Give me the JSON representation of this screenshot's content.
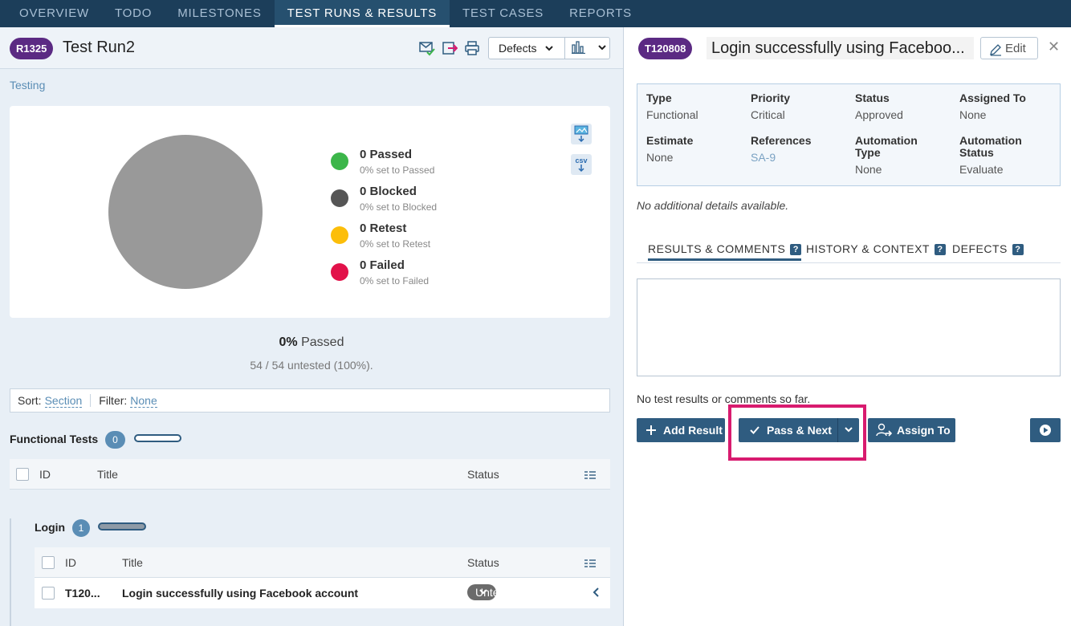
{
  "nav": {
    "tabs": [
      "OVERVIEW",
      "TODO",
      "MILESTONES",
      "TEST RUNS & RESULTS",
      "TEST CASES",
      "REPORTS"
    ],
    "active": "TEST RUNS & RESULTS"
  },
  "run": {
    "id": "R1325",
    "title": "Test Run2",
    "defects_label": "Defects",
    "link": "Testing"
  },
  "summary": {
    "legend": [
      {
        "main": "0 Passed",
        "sub": "0% set to Passed",
        "color": "#3cb64a"
      },
      {
        "main": "0 Blocked",
        "sub": "0% set to Blocked",
        "color": "#555555"
      },
      {
        "main": "0 Retest",
        "sub": "0% set to Retest",
        "color": "#fcbe0a"
      },
      {
        "main": "0 Failed",
        "sub": "0% set to Failed",
        "color": "#e2124a"
      }
    ],
    "csv_label": "csv",
    "passed_pct": "0%",
    "passed_word": "Passed",
    "untested": "54 / 54 untested (100%)."
  },
  "chart_data": {
    "type": "pie",
    "categories": [
      "Passed",
      "Blocked",
      "Retest",
      "Failed",
      "Untested"
    ],
    "values": [
      0,
      0,
      0,
      0,
      54
    ]
  },
  "sortbar": {
    "sort_label": "Sort:",
    "sort_value": "Section",
    "filter_label": "Filter:",
    "filter_value": "None"
  },
  "functional": {
    "title": "Functional Tests",
    "count": "0",
    "columns": {
      "id": "ID",
      "title": "Title",
      "status": "Status"
    }
  },
  "login": {
    "title": "Login",
    "count": "1",
    "columns": {
      "id": "ID",
      "title": "Title",
      "status": "Status"
    },
    "rows": [
      {
        "id": "T120...",
        "title": "Login successfully using Facebook account",
        "status": "Untested"
      }
    ]
  },
  "case": {
    "id": "T120808",
    "title": "Login successfully using Faceboo...",
    "edit_label": "Edit",
    "props": {
      "type_k": "Type",
      "type_v": "Functional",
      "priority_k": "Priority",
      "priority_v": "Critical",
      "status_k": "Status",
      "status_v": "Approved",
      "assigned_k": "Assigned To",
      "assigned_v": "None",
      "estimate_k": "Estimate",
      "estimate_v": "None",
      "refs_k": "References",
      "refs_v": "SA-9",
      "autotype_k1": "Automation",
      "autotype_k2": "Type",
      "autotype_v": "None",
      "autostatus_k1": "Automation",
      "autostatus_k2": "Status",
      "autostatus_v": "Evaluate"
    },
    "no_details": "No additional details available.",
    "tabs": [
      "RESULTS & COMMENTS",
      "HISTORY & CONTEXT",
      "DEFECTS"
    ],
    "help": "?",
    "no_results": "No test results or comments so far.",
    "buttons": {
      "add_result": "Add Result",
      "pass_next": "Pass & Next",
      "assign_to": "Assign To"
    }
  }
}
